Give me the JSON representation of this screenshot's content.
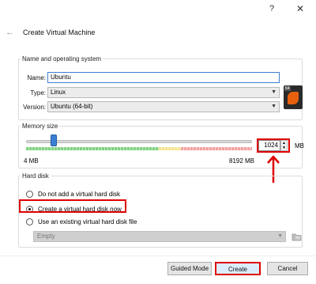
{
  "window": {
    "help_glyph": "?",
    "close_glyph": "✕"
  },
  "header": {
    "back_glyph": "←",
    "title": "Create Virtual Machine"
  },
  "name_os": {
    "legend": "Name and operating system",
    "name_label": "Name:",
    "name_value": "Ubuntu",
    "type_label": "Type:",
    "type_value": "Linux",
    "version_label": "Version:",
    "version_value": "Ubuntu (64-bit)",
    "os_icon_badge": "64"
  },
  "memory": {
    "legend": "Memory size",
    "min_label": "4 MB",
    "max_label": "8192 MB",
    "value": "1024",
    "unit": "MB",
    "slider_fraction": 0.125
  },
  "hard_disk": {
    "legend": "Hard disk",
    "options": [
      {
        "label": "Do not add a virtual hard disk",
        "checked": false
      },
      {
        "label": "Create a virtual hard disk now",
        "checked": true
      },
      {
        "label": "Use an existing virtual hard disk file",
        "checked": false
      }
    ],
    "disk_combo_value": "Empty"
  },
  "footer": {
    "guided_label": "Guided Mode",
    "create_label": "Create",
    "cancel_label": "Cancel"
  },
  "colors": {
    "highlight": "#e00000",
    "accent": "#3b7fd4"
  },
  "icons": {
    "help": "help-icon",
    "close": "close-icon",
    "back": "back-arrow-icon",
    "os": "ubuntu-os-icon",
    "folder": "folder-icon",
    "annotation_arrow": "red-arrow-icon"
  }
}
